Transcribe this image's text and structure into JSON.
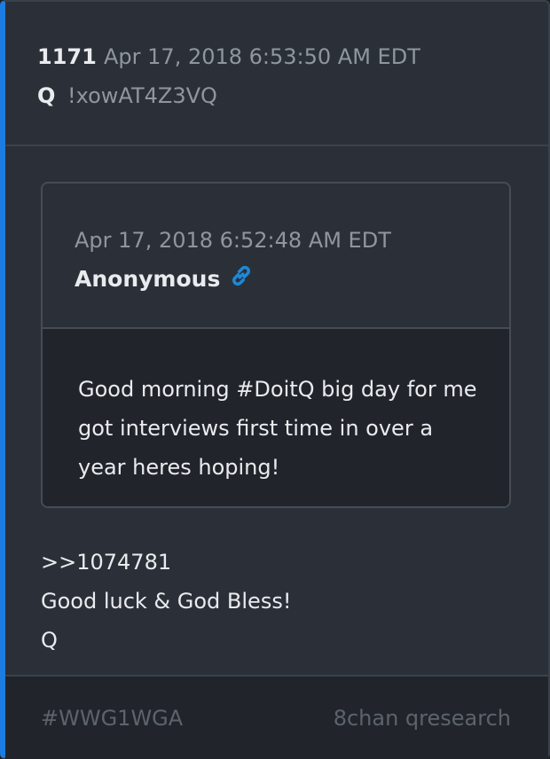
{
  "post": {
    "number": "1171",
    "timestamp": "Apr 17, 2018 6:53:50 AM EDT",
    "author": "Q",
    "tripcode": "!xowAT4Z3VQ"
  },
  "quoted_post": {
    "timestamp": "Apr 17, 2018 6:52:48 AM EDT",
    "author": "Anonymous",
    "link_icon": "link-icon",
    "text": "Good morning #DoitQ  big day for me got interviews first time in over a year heres hoping!"
  },
  "body": {
    "lines": [
      ">>1074781",
      "Good luck & God Bless!",
      "Q"
    ]
  },
  "footer": {
    "hashtag": "#WWG1WGA",
    "source": "8chan qresearch"
  },
  "colors": {
    "accent": "#1c7ce2",
    "background": "#2b3038",
    "quote_body": "#21252b",
    "text": "#e9ebee",
    "muted": "#8f969f"
  }
}
